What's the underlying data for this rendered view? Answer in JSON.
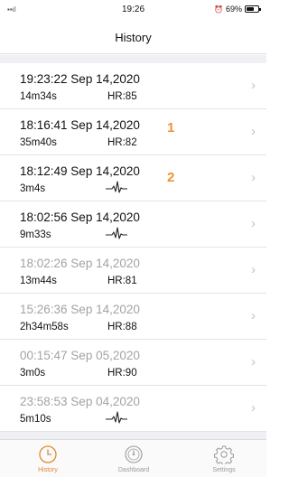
{
  "status_bar": {
    "time": "19:26",
    "battery": "69%",
    "battery_level": 0.69
  },
  "nav": {
    "title": "History"
  },
  "rows": [
    {
      "title": "19:23:22 Sep 14,2020",
      "duration": "14m34s",
      "hr": "HR:85",
      "badge": "",
      "dim": false,
      "ecg": false
    },
    {
      "title": "18:16:41 Sep 14,2020",
      "duration": "35m40s",
      "hr": "HR:82",
      "badge": "1",
      "dim": false,
      "ecg": false
    },
    {
      "title": "18:12:49 Sep 14,2020",
      "duration": "3m4s",
      "hr": "",
      "badge": "2",
      "dim": false,
      "ecg": true
    },
    {
      "title": "18:02:56 Sep 14,2020",
      "duration": "9m33s",
      "hr": "",
      "badge": "",
      "dim": false,
      "ecg": true
    },
    {
      "title": "18:02:26 Sep 14,2020",
      "duration": "13m44s",
      "hr": "HR:81",
      "badge": "",
      "dim": true,
      "ecg": false
    },
    {
      "title": "15:26:36 Sep 14,2020",
      "duration": "2h34m58s",
      "hr": "HR:88",
      "badge": "",
      "dim": true,
      "ecg": false
    },
    {
      "title": "00:15:47 Sep 05,2020",
      "duration": "3m0s",
      "hr": "HR:90",
      "badge": "",
      "dim": true,
      "ecg": false
    },
    {
      "title": "23:58:53 Sep 04,2020",
      "duration": "5m10s",
      "hr": "",
      "badge": "",
      "dim": true,
      "ecg": true
    }
  ],
  "tabs": [
    {
      "label": "History",
      "icon": "clock-icon",
      "active": true
    },
    {
      "label": "Dashboard",
      "icon": "gauge-icon",
      "active": false
    },
    {
      "label": "Settings",
      "icon": "gear-icon",
      "active": false
    }
  ],
  "colors": {
    "accent": "#e08a2f",
    "badge": "#f0922e",
    "dim_text": "#a3a3a3"
  }
}
